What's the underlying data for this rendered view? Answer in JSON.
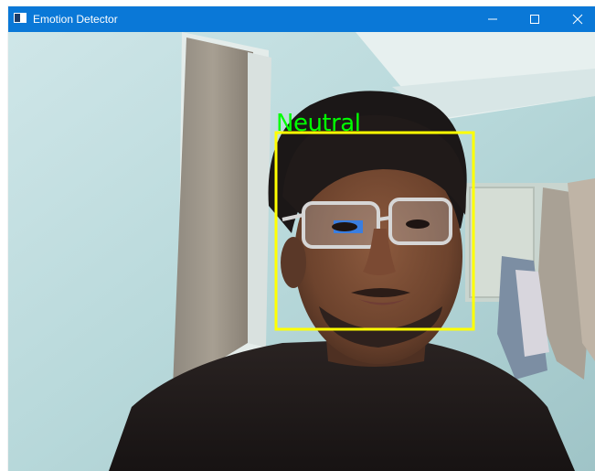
{
  "window": {
    "title": "Emotion Detector",
    "titlebar_color": "#0a78d7",
    "controls": {
      "minimize_icon": "minimize-icon",
      "maximize_icon": "maximize-icon",
      "close_icon": "close-icon"
    }
  },
  "detection": {
    "emotion_label": "Neutral",
    "label_color": "#00ff00",
    "box_color": "#ffff00"
  }
}
